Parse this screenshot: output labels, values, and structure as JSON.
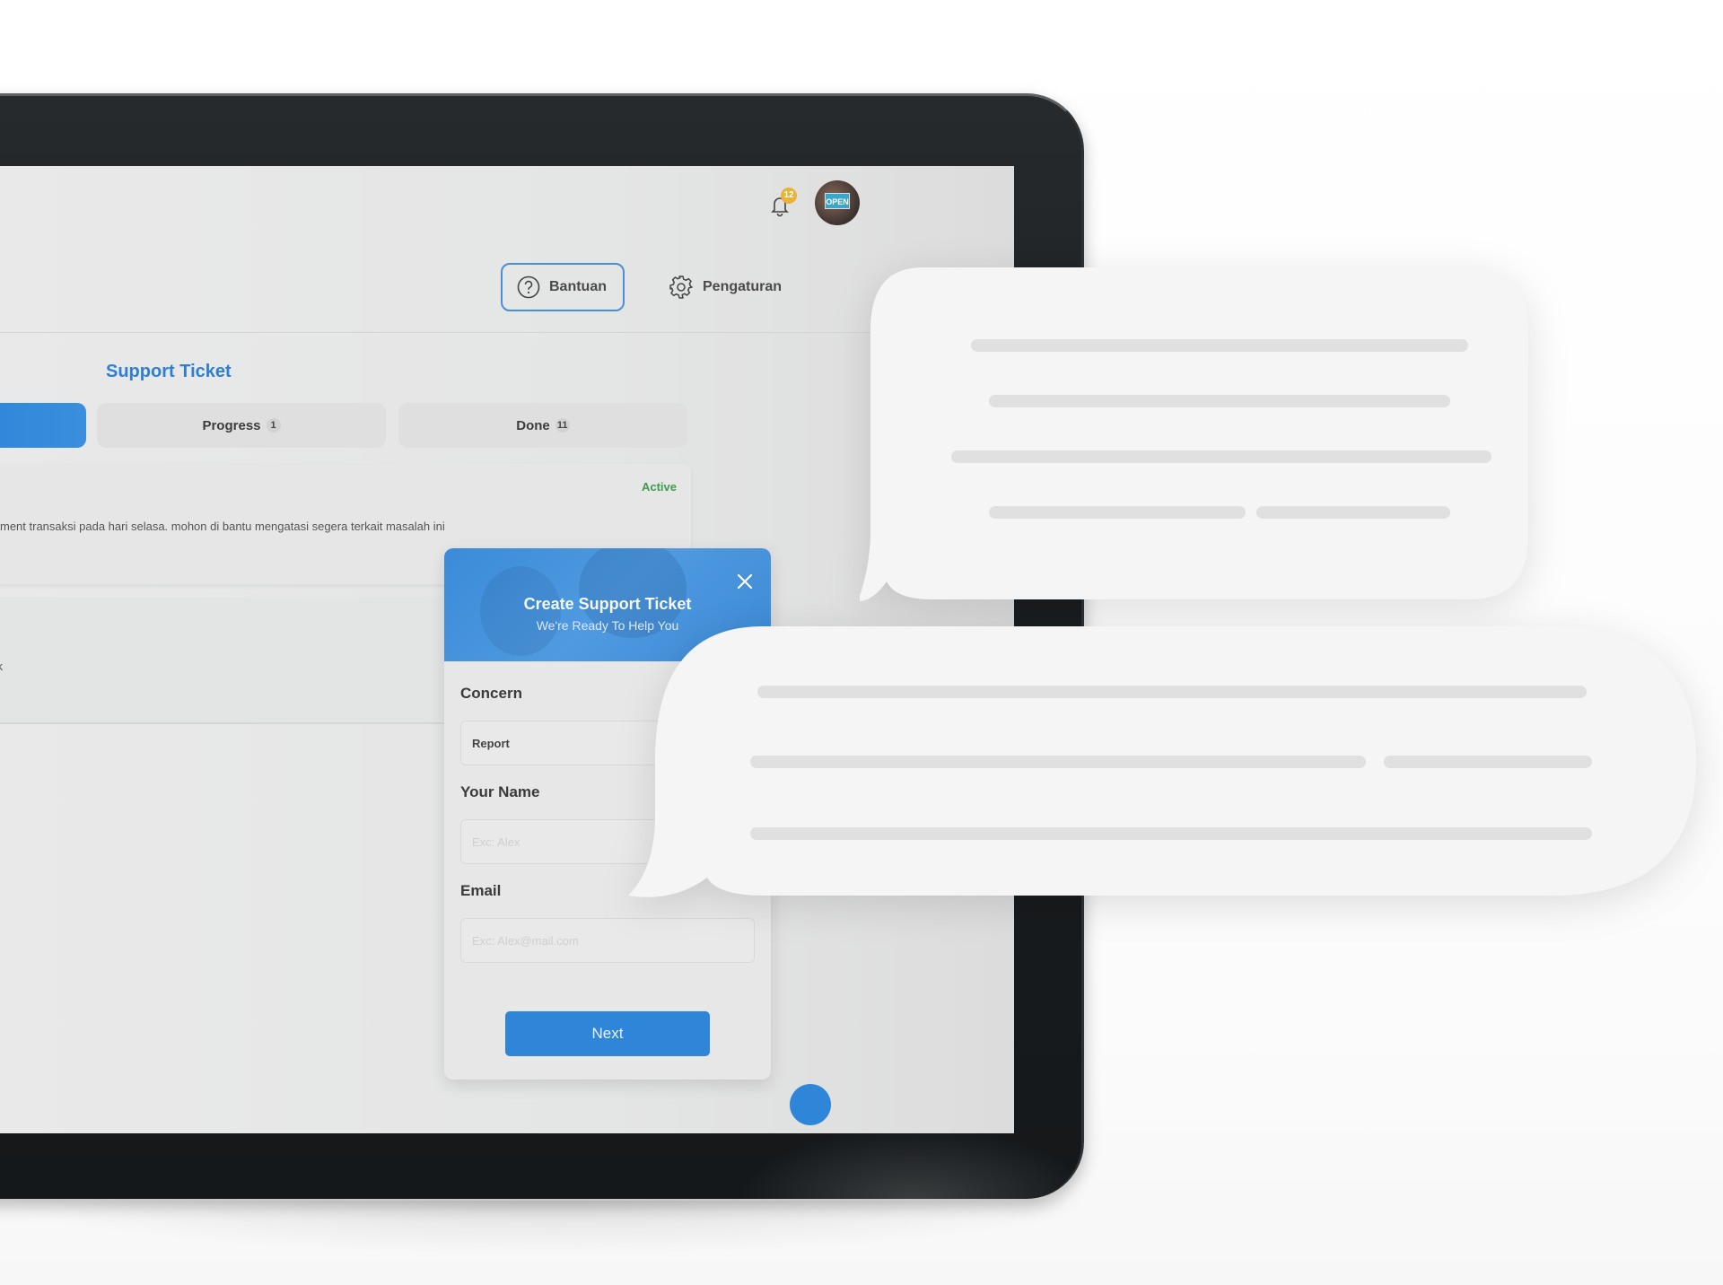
{
  "header": {
    "notification_count": "12",
    "avatar_sign": "OPEN",
    "help_button": "Bantuan",
    "settings_button": "Pengaturan"
  },
  "page": {
    "title": "Support Ticket",
    "tabs": [
      {
        "label": "",
        "count": "",
        "active": true
      },
      {
        "label": "Progress",
        "count": "1",
        "active": false
      },
      {
        "label": "Done",
        "count": "11",
        "active": false
      }
    ]
  },
  "tickets": [
    {
      "status": "Active",
      "description": "ment transaksi pada hari selasa. mohon di bantu mengatasi segera terkait masalah ini"
    },
    {
      "fragment": "ck"
    }
  ],
  "modal": {
    "title": "Create Support Ticket",
    "subtitle": "We're Ready To Help You",
    "fields": {
      "concern": {
        "label": "Concern",
        "value": "Report"
      },
      "name": {
        "label": "Your Name",
        "placeholder": "Exc: Alex",
        "value": ""
      },
      "email": {
        "label": "Email",
        "placeholder": "Exc: Alex@mail.com",
        "value": ""
      }
    },
    "next_button": "Next"
  },
  "colors": {
    "accent": "#2f86d9",
    "status_active": "#3f9a4e",
    "badge": "#e9b33a"
  }
}
